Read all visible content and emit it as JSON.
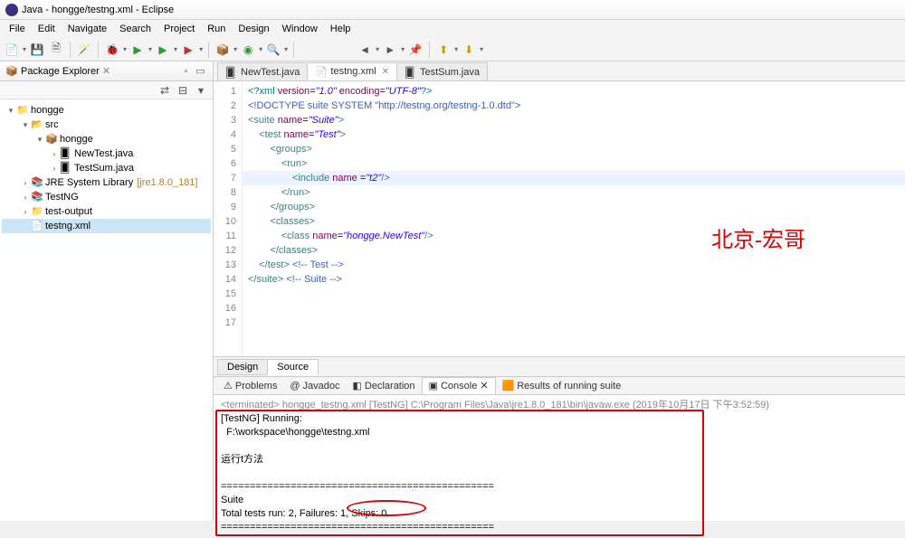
{
  "window": {
    "title": "Java - hongge/testng.xml - Eclipse"
  },
  "menu": [
    "File",
    "Edit",
    "Navigate",
    "Search",
    "Project",
    "Run",
    "Design",
    "Window",
    "Help"
  ],
  "sidebar": {
    "title": "Package Explorer",
    "tree": [
      {
        "d": 0,
        "tw": "▾",
        "icon": "prj",
        "label": "hongge"
      },
      {
        "d": 1,
        "tw": "▾",
        "icon": "src",
        "label": "src"
      },
      {
        "d": 2,
        "tw": "▾",
        "icon": "pkg",
        "label": "hongge"
      },
      {
        "d": 3,
        "tw": "›",
        "icon": "java",
        "label": "NewTest.java"
      },
      {
        "d": 3,
        "tw": "›",
        "icon": "java",
        "label": "TestSum.java"
      },
      {
        "d": 1,
        "tw": "›",
        "icon": "lib",
        "label": "JRE System Library",
        "hint": "[jre1.8.0_181]"
      },
      {
        "d": 1,
        "tw": "›",
        "icon": "lib",
        "label": "TestNG"
      },
      {
        "d": 1,
        "tw": "›",
        "icon": "fld",
        "label": "test-output"
      },
      {
        "d": 1,
        "tw": "",
        "icon": "xml",
        "label": "testng.xml",
        "sel": true
      }
    ]
  },
  "editor": {
    "tabs": [
      {
        "label": "NewTest.java",
        "icon": "java"
      },
      {
        "label": "testng.xml",
        "icon": "xml",
        "active": true,
        "close": true
      },
      {
        "label": "TestSum.java",
        "icon": "java"
      }
    ],
    "bottom_tabs": {
      "design": "Design",
      "source": "Source"
    },
    "watermark": "北京-宏哥",
    "code_lines": [
      "<span class='pi'>&lt;?xml</span> <span class='attr'>version</span>=<span class='str'>\"1.0\"</span> <span class='attr'>encoding</span>=<span class='str'>\"UTF-8\"</span><span class='pi'>?&gt;</span>",
      "<span class='cmt'>&lt;!DOCTYPE suite SYSTEM \"http://testng.org/testng-1.0.dtd\"&gt;</span>",
      "<span class='kw'>&lt;suite</span> <span class='attr'>name</span>=<span class='str'>\"Suite\"</span><span class='kw'>&gt;</span>",
      "    <span class='kw'>&lt;test</span> <span class='attr'>name</span>=<span class='str'>\"Test\"</span><span class='kw'>&gt;</span>",
      "        <span class='kw'>&lt;groups&gt;</span>",
      "            <span class='kw'>&lt;run&gt;</span>",
      "                <span class='kw'>&lt;include</span> <span class='attr'>name</span> =<span class='str'>\"t2\"</span><span class='kw'>/&gt;</span>",
      "            <span class='kw'>&lt;/run&gt;</span>",
      "        <span class='kw'>&lt;/groups&gt;</span>",
      "        <span class='kw'>&lt;classes&gt;</span>",
      "            <span class='kw'>&lt;class</span> <span class='attr'>name</span>=<span class='str'>\"hongge.NewTest\"</span><span class='kw'>/&gt;</span>",
      "        <span class='kw'>&lt;/classes&gt;</span>",
      "    <span class='kw'>&lt;/test&gt;</span> <span class='cmt'>&lt;!-- Test --&gt;</span>",
      "<span class='kw'>&lt;/suite&gt;</span> <span class='cmt'>&lt;!-- Suite --&gt;</span>",
      "",
      "",
      ""
    ]
  },
  "console": {
    "tabs": [
      {
        "label": "Problems",
        "icon": "prob"
      },
      {
        "label": "Javadoc",
        "icon": "jdoc",
        "at": "@ "
      },
      {
        "label": "Declaration",
        "icon": "decl"
      },
      {
        "label": "Console",
        "icon": "cons",
        "active": true,
        "close": true
      },
      {
        "label": "Results of running suite",
        "icon": "ng"
      }
    ],
    "header": "<terminated> hongge_testng.xml [TestNG] C:\\Program Files\\Java\\jre1.8.0_181\\bin\\javaw.exe (2019年10月17日 下午3:52:59)",
    "lines": [
      "[TestNG] Running:",
      "  F:\\workspace\\hongge\\testng.xml",
      "",
      "运行t方法",
      "",
      "===============================================",
      "Suite",
      "Total tests run: 2, Failures: 1, Skips: 0",
      "==============================================="
    ]
  }
}
